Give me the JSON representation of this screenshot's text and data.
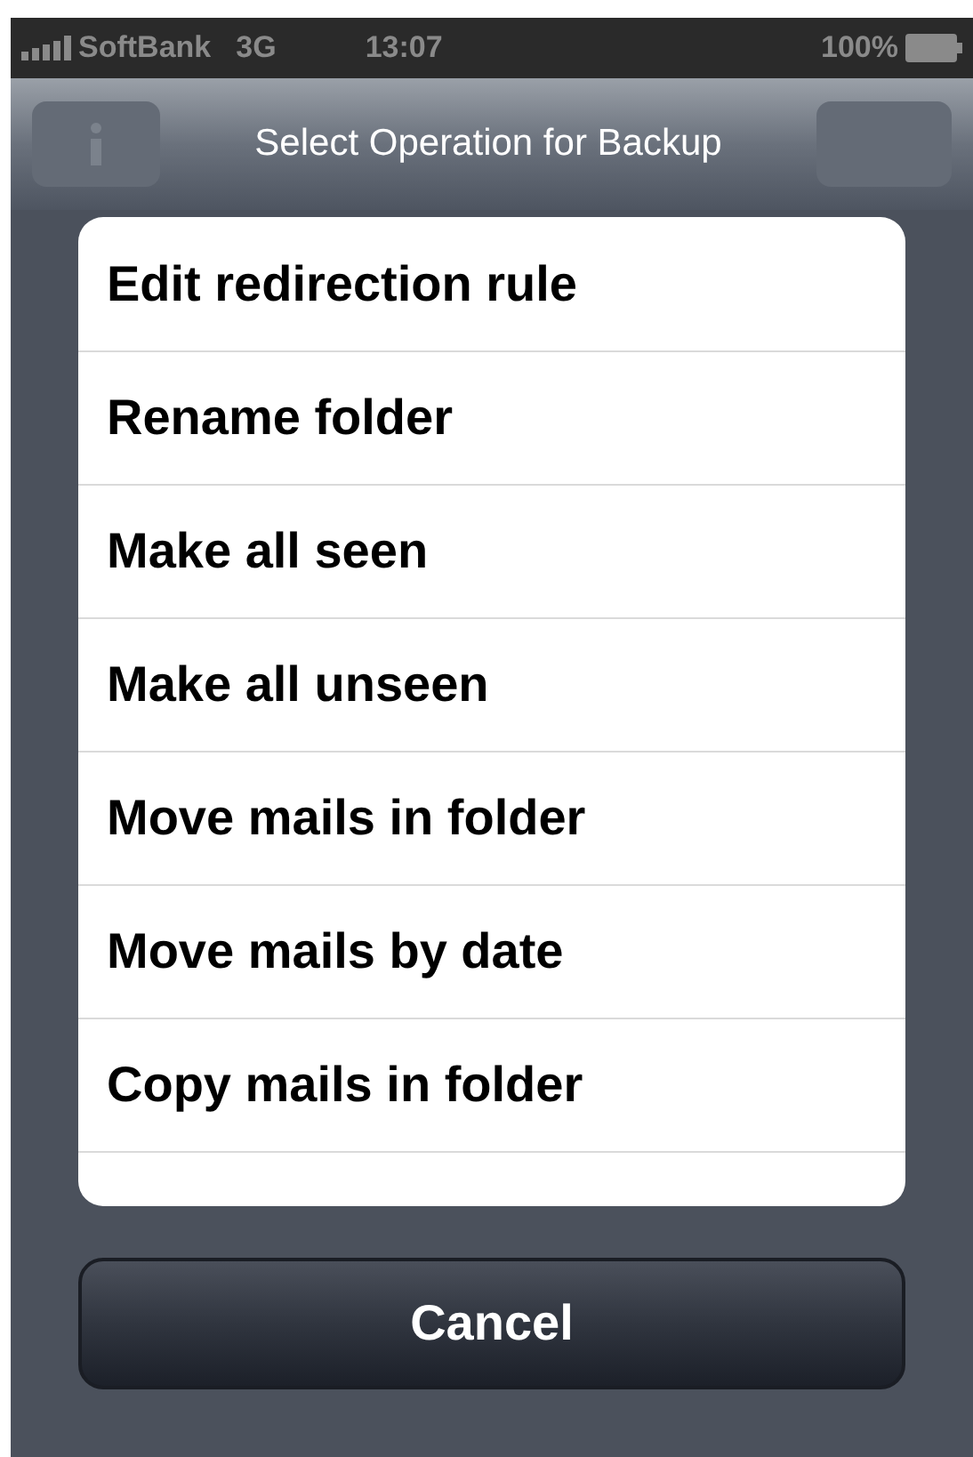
{
  "status_bar": {
    "carrier": "SoftBank",
    "network": "3G",
    "time": "13:07",
    "battery": "100%"
  },
  "nav_bar": {
    "title": "Select Operation for Backup"
  },
  "operations": [
    "Edit redirection rule",
    "Rename folder",
    "Make all seen",
    "Make all unseen",
    "Move mails in folder",
    "Move mails by date",
    "Copy mails in folder"
  ],
  "cancel_button": "Cancel"
}
